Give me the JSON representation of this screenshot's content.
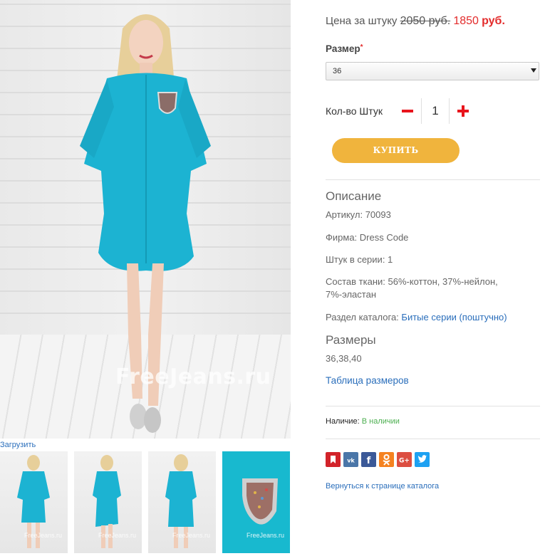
{
  "gallery": {
    "main_watermark": "FreeJeans.ru",
    "upload_label": "Загрузить",
    "thumb_watermark": "FreeJeans.ru"
  },
  "price": {
    "label": "Цена за штуку",
    "old": "2050 руб.",
    "new": "1850",
    "currency": "руб."
  },
  "size": {
    "label": "Размер",
    "required_mark": "*",
    "selected": "36"
  },
  "quantity": {
    "label": "Кол-во Штук",
    "value": "1"
  },
  "buy_button": "КУПИТЬ",
  "description": {
    "title": "Описание",
    "article": "Артикул: 70093",
    "brand": "Фирма: Dress Code",
    "per_series": "Штук в серии: 1",
    "composition_line1": "Состав ткани: 56%-коттон, 37%-нейлон,",
    "composition_line2": "7%-эластан",
    "catalog_label": "Раздел каталога:",
    "catalog_link": "Битые серии (поштучно)"
  },
  "sizes": {
    "title": "Размеры",
    "list": "36,38,40",
    "table_link": "Таблица размеров"
  },
  "availability": {
    "label": "Наличие:",
    "value": "В наличии"
  },
  "social": [
    "bookmark-icon",
    "vk-icon",
    "facebook-icon",
    "odnoklassniki-icon",
    "google-plus-icon",
    "twitter-icon"
  ],
  "back_link": "Вернуться к странице каталога",
  "colors": {
    "accent_red": "#e32b2b",
    "buy_button": "#f0b43d",
    "link_blue": "#2a6ebb",
    "available_green": "#4caf50",
    "dress_turquoise": "#1cb3d2"
  }
}
